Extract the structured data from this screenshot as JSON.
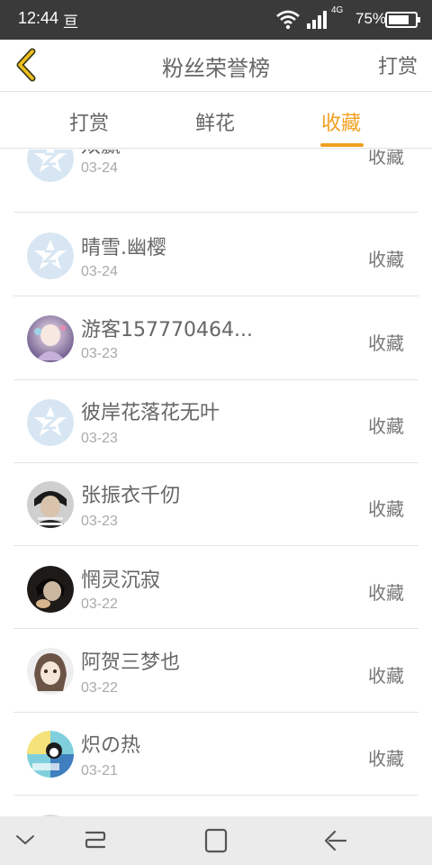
{
  "status": {
    "time": "12:44",
    "app_note": "亘",
    "network": "4G",
    "battery": "75%"
  },
  "header": {
    "title": "粉丝荣誉榜",
    "action": "打赏"
  },
  "tabs": [
    {
      "label": "打赏"
    },
    {
      "label": "鲜花"
    },
    {
      "label": "收藏"
    }
  ],
  "active_tab": "收藏",
  "accent_color": "#f0a020",
  "fans": [
    {
      "name": "双赢",
      "date": "03-24",
      "gift": "收藏",
      "avatar": "default-star-avatar"
    },
    {
      "name": "晴雪.幽樱",
      "date": "03-24",
      "gift": "收藏",
      "avatar": "default-star-avatar"
    },
    {
      "name": "游客157770464...",
      "date": "03-23",
      "gift": "收藏",
      "avatar": "anime-girl-avatar"
    },
    {
      "name": "彼岸花落花无叶",
      "date": "03-23",
      "gift": "收藏",
      "avatar": "default-star-avatar"
    },
    {
      "name": "张振衣千仞",
      "date": "03-23",
      "gift": "收藏",
      "avatar": "portrait-avatar"
    },
    {
      "name": "惘灵沉寂",
      "date": "03-22",
      "gift": "收藏",
      "avatar": "dark-portrait-avatar"
    },
    {
      "name": "阿贺三梦也",
      "date": "03-22",
      "gift": "收藏",
      "avatar": "anime-face-avatar"
    },
    {
      "name": "炽の热",
      "date": "03-21",
      "gift": "收藏",
      "avatar": "colorful-avatar"
    }
  ]
}
